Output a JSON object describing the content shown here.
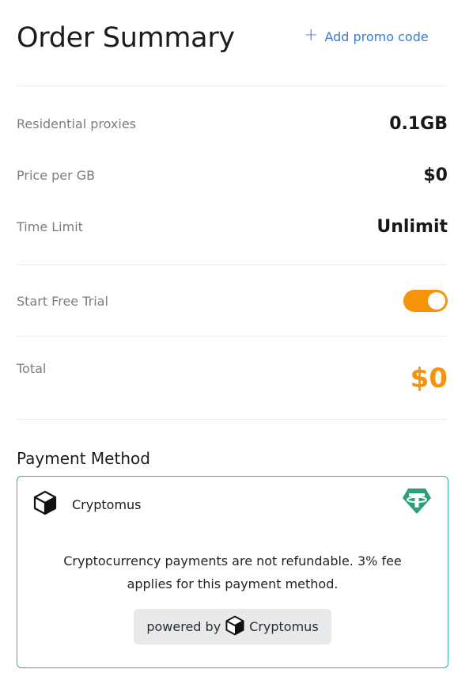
{
  "header": {
    "title": "Order Summary",
    "promo_icon": "plus-icon",
    "promo_label": "Add promo code"
  },
  "summary": {
    "rows": [
      {
        "label": "Residential proxies",
        "value": "0.1GB"
      },
      {
        "label": "Price per GB",
        "value": "$0"
      },
      {
        "label": "Time Limit",
        "value": "Unlimit"
      }
    ],
    "free_trial": {
      "label": "Start Free Trial",
      "enabled": true
    },
    "total": {
      "label": "Total",
      "value": "$0"
    }
  },
  "payment": {
    "title": "Payment Method",
    "method": {
      "name": "Cryptomus",
      "icon": "cryptomus-cube-icon",
      "badge_icon": "tether-icon",
      "note": "Cryptocurrency payments are not refundable. 3% fee applies for this payment method.",
      "powered_prefix": "powered by",
      "powered_brand": "Cryptomus"
    }
  },
  "colors": {
    "accent": "#f5930b",
    "link": "#3a7bd5",
    "card_border": "#2bb0a4",
    "tether": "#26a17b"
  }
}
